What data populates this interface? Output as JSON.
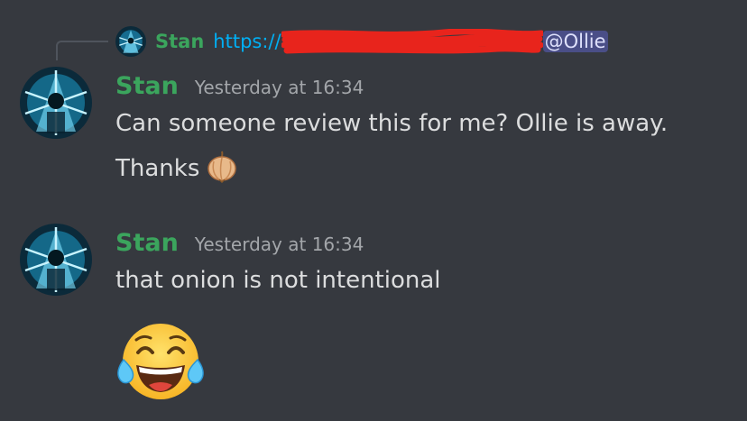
{
  "reply": {
    "author": "Stan",
    "link_text": "https://",
    "mention": "@Ollie",
    "avatar_icon": "avatar-icon"
  },
  "messages": [
    {
      "author": "Stan",
      "timestamp": "Yesterday at 16:34",
      "lines": [
        "Can someone review this for me? Ollie is away.",
        "Thanks"
      ],
      "emoji": "onion-emoji"
    },
    {
      "author": "Stan",
      "timestamp": "Yesterday at 16:34",
      "lines": [
        "that onion is not intentional"
      ],
      "emoji": "tears-of-joy-emoji"
    }
  ],
  "colors": {
    "background": "#36393f",
    "username": "#3ba55d",
    "text": "#dcddde",
    "timestamp": "#a3a6aa",
    "link": "#00aff4",
    "mention_bg": "#4a4e87",
    "redaction": "#e8241c"
  }
}
